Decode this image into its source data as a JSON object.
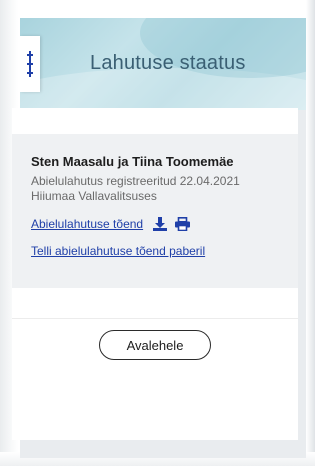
{
  "header": {
    "title": "Lahutuse staatus"
  },
  "status_card": {
    "names": "Sten Maasalu ja Tiina Toomemäe",
    "registration_line1": "Abielulahutus registreeritud 22.04.2021",
    "registration_line2": "Hiiumaa Vallavalitsuses",
    "certificate_link": "Abielulahutuse tõend",
    "order_paper_link": "Telli abielulahutuse tõend paberil"
  },
  "footer": {
    "home_button": "Avalehele"
  },
  "icons": {
    "menu": "menu-icon",
    "download": "download-icon",
    "print": "print-icon"
  },
  "colors": {
    "accent": "#1f3fa8",
    "header_text": "#3a5f73"
  }
}
